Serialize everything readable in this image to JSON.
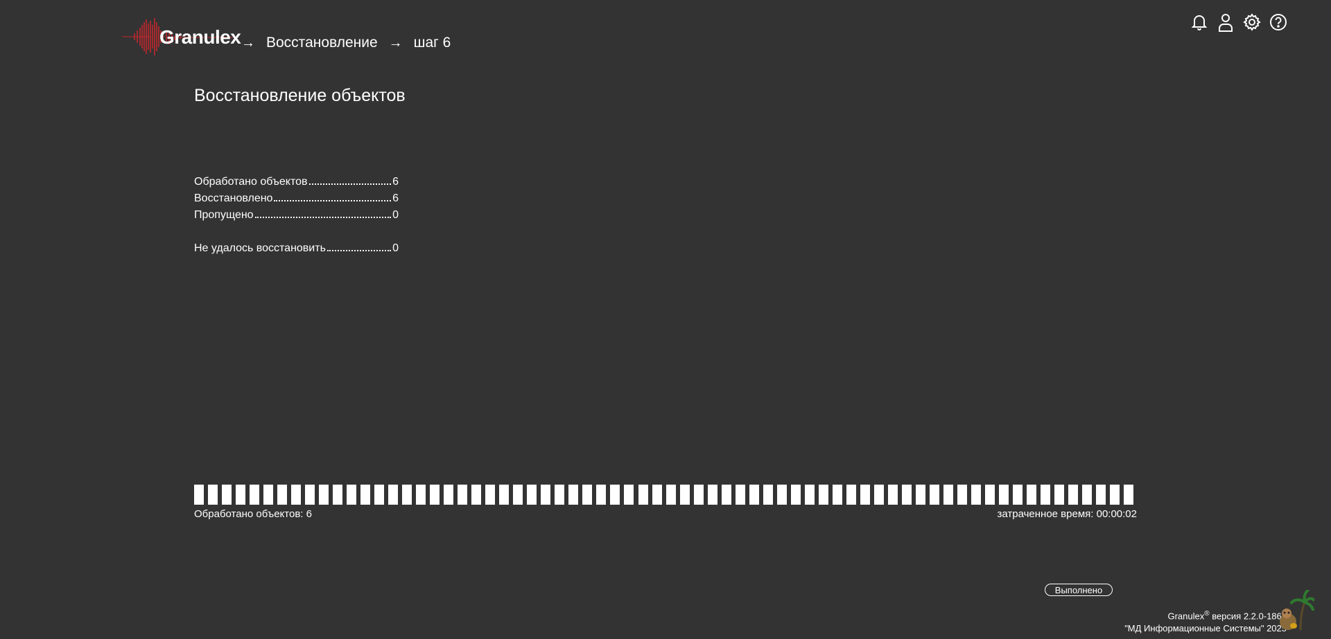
{
  "header": {
    "logo_text": "Granulex",
    "breadcrumb": [
      "Восстановление",
      "шаг 6"
    ],
    "icons": [
      "bell-icon",
      "user-icon",
      "gear-icon",
      "help-icon"
    ]
  },
  "main": {
    "title": "Восстановление объектов",
    "stats": [
      {
        "label": "Обработано объектов",
        "value": "6"
      },
      {
        "label": "Восстановлено",
        "value": "6"
      },
      {
        "label": "Пропущено",
        "value": "0"
      },
      {
        "label": "Не удалось восстановить",
        "value": "0"
      }
    ],
    "progress": {
      "fraction": 1.0,
      "segments": 68,
      "processed_label": "Обработано объектов: 6",
      "elapsed_label": "затраченное время: 00:00:02"
    },
    "done_button": "Выполнено"
  },
  "footer": {
    "brand": "Granulex",
    "reg_mark": "®",
    "version": " версия 2.2.0-1863",
    "company": "\"МД Информационные Системы\" 2025"
  },
  "colors": {
    "background": "#333333",
    "logo_red": "#c0272d",
    "foreground": "#ffffff"
  }
}
